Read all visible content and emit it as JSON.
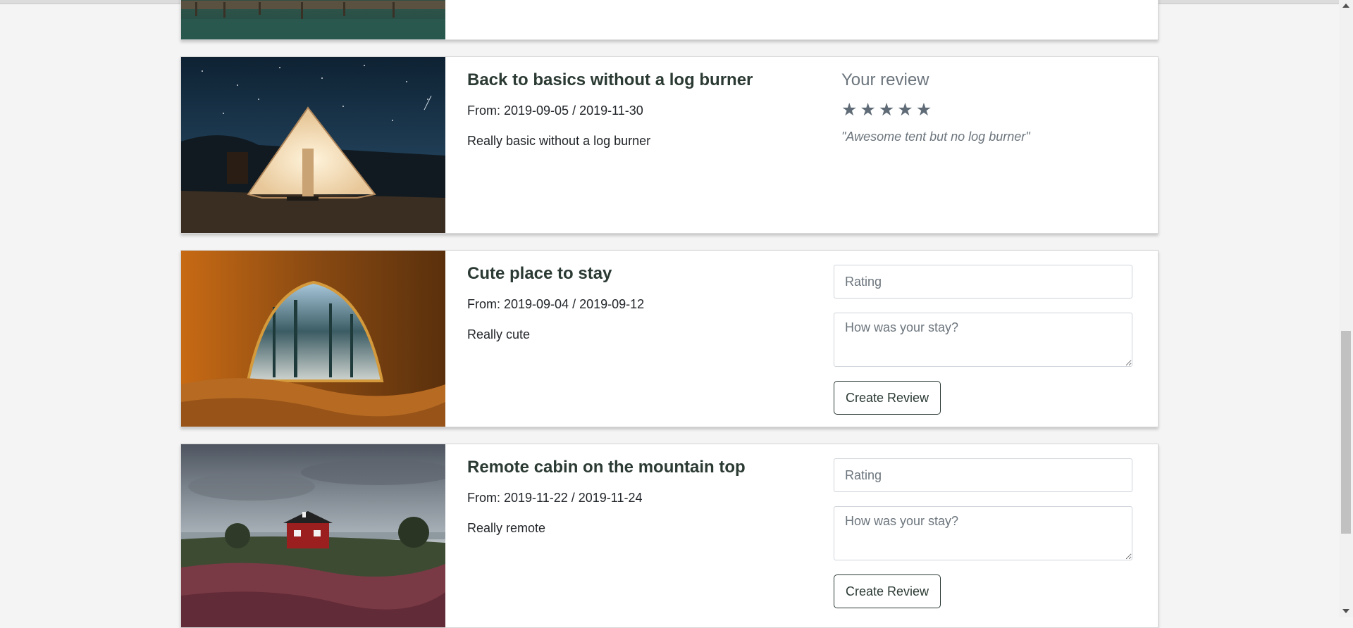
{
  "bookings": [
    {
      "image": "lake-pier-photo"
    },
    {
      "title": "Back to basics without a log burner",
      "dates": "From: 2019-09-05 / 2019-11-30",
      "description": "Really basic without a log burner",
      "image": "bell-tent-night-photo",
      "review": {
        "heading": "Your review",
        "stars": 5,
        "star_icon": "star-icon",
        "quote": "\"Awesome tent but no log burner\""
      }
    },
    {
      "title": "Cute place to stay",
      "dates": "From: 2019-09-04 / 2019-09-12",
      "description": "Really cute",
      "image": "tent-view-forest-photo",
      "form": {
        "rating_placeholder": "Rating",
        "comment_placeholder": "How was your stay?",
        "button_label": "Create Review"
      }
    },
    {
      "title": "Remote cabin on the mountain top",
      "dates": "From: 2019-11-22 / 2019-11-24",
      "description": "Really remote",
      "image": "red-cabin-photo",
      "form": {
        "rating_placeholder": "Rating",
        "comment_placeholder": "How was your stay?",
        "button_label": "Create Review"
      }
    }
  ],
  "colors": {
    "page_background": "#f4f4f4",
    "title": "#2b3a33",
    "muted": "#6c757d",
    "star": "#5f6b76"
  },
  "scrollbar": {
    "up_icon": "chevron-up-icon",
    "down_icon": "chevron-down-icon"
  }
}
